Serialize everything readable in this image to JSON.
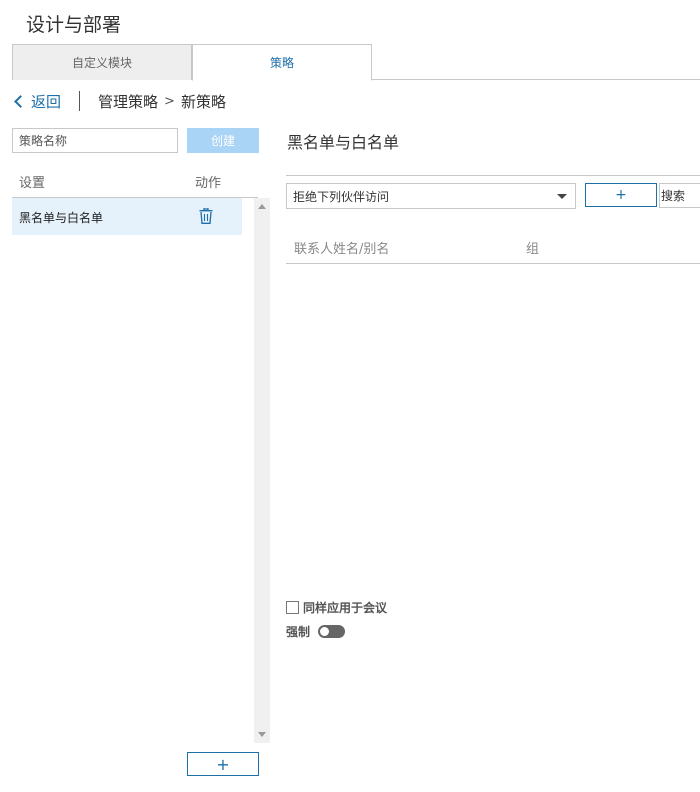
{
  "header": {
    "title": "设计与部署"
  },
  "tabs": [
    {
      "label": "自定义模块"
    },
    {
      "label": "策略"
    }
  ],
  "breadcrumb": {
    "back_label": "返回",
    "items": [
      "管理策略",
      "新策略"
    ],
    "separator": ">"
  },
  "left_panel": {
    "name_input": {
      "placeholder": "策略名称",
      "value": ""
    },
    "create_label": "创建",
    "columns": {
      "settings": "设置",
      "action": "动作"
    },
    "items": [
      {
        "label": "黑名单与白名单"
      }
    ],
    "add_label": "+"
  },
  "right_panel": {
    "title": "黑名单与白名单",
    "rule_select": {
      "value": "拒绝下列伙伴访问"
    },
    "add_label": "+",
    "search_label": "搜索",
    "table_columns": {
      "contact": "联系人姓名/别名",
      "group": "组"
    },
    "apply_meeting_label": "同样应用于会议",
    "apply_meeting_checked": false,
    "force_label": "强制",
    "force_on": false
  },
  "colors": {
    "accent": "#1e6fa8",
    "selected_row": "#e5f1fb",
    "create_disabled": "#a9d4f5"
  }
}
